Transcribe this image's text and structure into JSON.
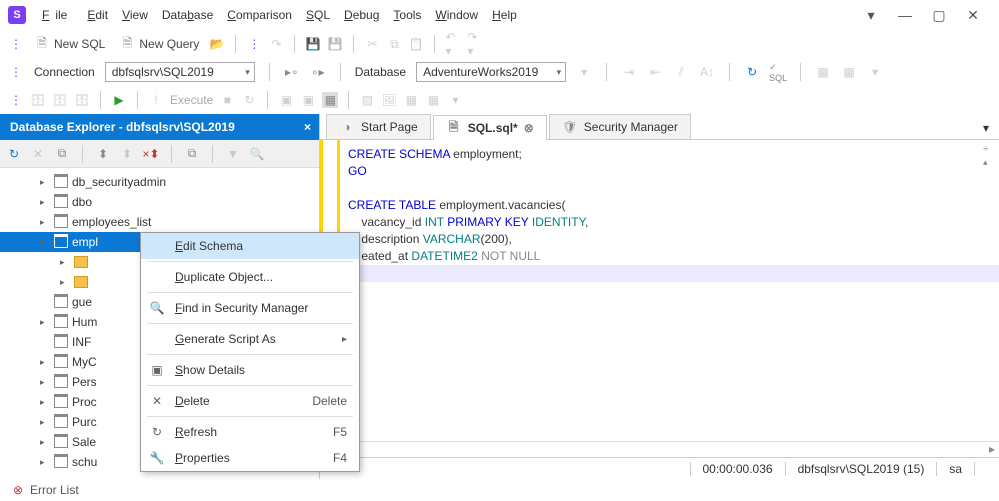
{
  "menu": {
    "file": "File",
    "edit": "Edit",
    "view": "View",
    "database": "Database",
    "comparison": "Comparison",
    "sql": "SQL",
    "debug": "Debug",
    "tools": "Tools",
    "window": "Window",
    "help": "Help"
  },
  "toolbar": {
    "new_sql": "New SQL",
    "new_query": "New Query",
    "execute": "Execute"
  },
  "connection": {
    "label": "Connection",
    "value": "dbfsqlsrv\\SQL2019",
    "db_label": "Database",
    "db_value": "AdventureWorks2019"
  },
  "explorer": {
    "title": "Database Explorer - dbfsqlsrv\\SQL2019",
    "nodes": [
      {
        "label": "db_securityadmin",
        "type": "schema",
        "arr": "▸"
      },
      {
        "label": "dbo",
        "type": "schema",
        "arr": "▸"
      },
      {
        "label": "employees_list",
        "type": "schema",
        "arr": "▸"
      },
      {
        "label": "empl",
        "type": "schema",
        "arr": "▾",
        "sel": true
      },
      {
        "label": "",
        "type": "folder",
        "arr": "▸",
        "sub": true
      },
      {
        "label": "",
        "type": "folder",
        "arr": "▸",
        "sub": true
      },
      {
        "label": "gue",
        "type": "schema",
        "arr": ""
      },
      {
        "label": "Hum",
        "type": "schema",
        "arr": "▸"
      },
      {
        "label": "INF",
        "type": "schema",
        "arr": ""
      },
      {
        "label": "MyC",
        "type": "schema",
        "arr": "▸"
      },
      {
        "label": "Pers",
        "type": "schema",
        "arr": "▸"
      },
      {
        "label": "Proc",
        "type": "schema",
        "arr": "▸"
      },
      {
        "label": "Purc",
        "type": "schema",
        "arr": "▸"
      },
      {
        "label": "Sale",
        "type": "schema",
        "arr": "▸"
      },
      {
        "label": "schu",
        "type": "schema",
        "arr": "▸"
      }
    ]
  },
  "tabs": [
    {
      "label": "Start Page",
      "icon": "⭘"
    },
    {
      "label": "SQL.sql*",
      "icon": "sql",
      "active": true,
      "close": true
    },
    {
      "label": "Security Manager",
      "icon": "shield"
    }
  ],
  "code": {
    "l1": "CREATE SCHEMA employment;",
    "l2": "GO",
    "l3": "",
    "l4": "CREATE TABLE employment.vacancies(",
    "l5": "    vacancy_id INT PRIMARY KEY IDENTITY,",
    "l6": "    description VARCHAR(200),",
    "l7": "    eated_at DATETIME2 NOT NULL"
  },
  "context": [
    {
      "label": "Edit Schema",
      "hl": true
    },
    {
      "sep": true
    },
    {
      "label": "Duplicate Object..."
    },
    {
      "sep": true
    },
    {
      "label": "Find in Security Manager",
      "icon": "🔍"
    },
    {
      "sep": true
    },
    {
      "label": "Generate Script As",
      "sub": true
    },
    {
      "sep": true
    },
    {
      "label": "Show Details",
      "icon": "▣"
    },
    {
      "sep": true
    },
    {
      "label": "Delete",
      "shortcut": "Delete",
      "icon": "✕",
      "iconcolor": "red"
    },
    {
      "sep": true
    },
    {
      "label": "Refresh",
      "shortcut": "F5",
      "icon": "↻",
      "iconcolor": "blue"
    },
    {
      "label": "Properties",
      "shortcut": "F4",
      "icon": "🔧"
    }
  ],
  "status": {
    "time": "00:00:00.036",
    "conn": "dbfsqlsrv\\SQL2019 (15)",
    "user": "sa"
  },
  "errorlist": "Error List"
}
